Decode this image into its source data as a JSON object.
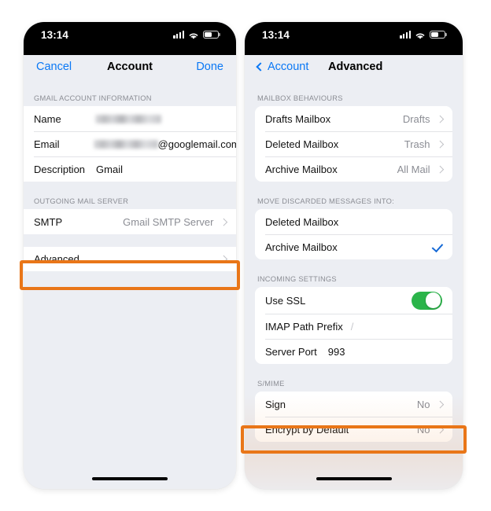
{
  "phones": {
    "left": {
      "status_bar": {
        "time": "13:14",
        "icons": [
          "cellular-signal-icon",
          "wifi-icon",
          "battery-icon"
        ]
      },
      "navbar": {
        "cancel_label": "Cancel",
        "title": "Account",
        "done_label": "Done"
      },
      "sections": [
        {
          "header": "GMAIL ACCOUNT INFORMATION",
          "rows": [
            {
              "label": "Name",
              "value": "",
              "redacted": true,
              "chevron": false
            },
            {
              "label": "Email",
              "value": "@googlemail.com",
              "redacted": true,
              "chevron": false
            },
            {
              "label": "Description",
              "value": "Gmail",
              "redacted": false,
              "chevron": false
            }
          ]
        },
        {
          "header": "OUTGOING MAIL SERVER",
          "rows": [
            {
              "label": "SMTP",
              "value": "Gmail SMTP Server",
              "redacted": false,
              "chevron": true
            }
          ]
        },
        {
          "header": "",
          "rows": [
            {
              "label": "Advanced",
              "value": "",
              "redacted": false,
              "chevron": true,
              "highlighted": true
            }
          ]
        }
      ]
    },
    "right": {
      "status_bar": {
        "time": "13:14",
        "icons": [
          "cellular-signal-icon",
          "wifi-icon",
          "battery-icon"
        ]
      },
      "navbar": {
        "back_label": "Account",
        "title": "Advanced"
      },
      "sections": [
        {
          "header": "MAILBOX BEHAVIOURS",
          "rows": [
            {
              "label": "Drafts Mailbox",
              "value": "Drafts",
              "chevron": true
            },
            {
              "label": "Deleted Mailbox",
              "value": "Trash",
              "chevron": true
            },
            {
              "label": "Archive Mailbox",
              "value": "All Mail",
              "chevron": true
            }
          ]
        },
        {
          "header": "MOVE DISCARDED MESSAGES INTO:",
          "rows": [
            {
              "label": "Deleted Mailbox",
              "value": "",
              "checked": false
            },
            {
              "label": "Archive Mailbox",
              "value": "",
              "checked": true
            }
          ]
        },
        {
          "header": "INCOMING SETTINGS",
          "rows": [
            {
              "label": "Use SSL",
              "value": "",
              "toggle": true,
              "toggle_on": true
            },
            {
              "label": "IMAP Path Prefix",
              "value": "/",
              "inline_value": true
            },
            {
              "label": "Server Port",
              "value": "993",
              "inline_value": true
            }
          ]
        },
        {
          "header": "S/MIME",
          "rows": [
            {
              "label": "Sign",
              "value": "No",
              "chevron": true
            },
            {
              "label": "Encrypt by Default",
              "value": "No",
              "chevron": true,
              "highlighted": true
            }
          ]
        }
      ]
    }
  },
  "highlights": {
    "color": "#e97618",
    "targets": [
      "Advanced",
      "Encrypt by Default"
    ]
  },
  "colors": {
    "accent_blue": "#0a78f5",
    "toggle_green": "#2bb44a",
    "check_blue": "#1569d6",
    "highlight_orange": "#e97618",
    "screen_bg": "#eceef3",
    "card_bg": "#ffffff",
    "secondary_text": "#8b8d94"
  }
}
